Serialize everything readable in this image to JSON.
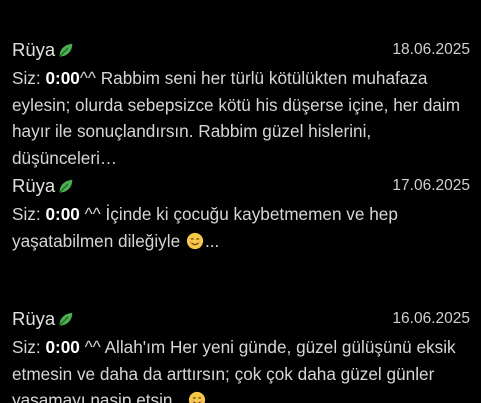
{
  "messages": [
    {
      "sender": "Rüya",
      "date": "18.06.2025",
      "prefix": "Siz: ",
      "time": "0:00",
      "text": "^^ Rabbim seni her türlü kötülükten muhafaza eylesin; olurda sebepsizce kötü his düşerse içine, her daim hayır ile sonuçlandırsın. Rabbim güzel hislerini, düşünceleri…",
      "tail": ""
    },
    {
      "sender": "Rüya",
      "date": "17.06.2025",
      "prefix": "Siz: ",
      "time": "0:00",
      "text": " ^^ İçinde ki çocuğu kaybetmemen ve hep yaşatabilmen dileğiyle ",
      "tail": "..."
    },
    {
      "sender": "Rüya",
      "date": "16.06.2025",
      "prefix": "Siz: ",
      "time": "0:00",
      "text": " ^^ Allah'ım Her yeni günde, güzel gülüşünü eksik etmesin ve daha da arttırsın; çok çok daha güzel günler yaşamayı nasip etsin.. ",
      "tail": ""
    }
  ],
  "icons": {
    "sender_badge": "leaf-icon",
    "message_emoji": "smiling-face-icon"
  },
  "colors": {
    "background": "#000000",
    "leaf": "#4caf50",
    "emoji": "#f7c948"
  }
}
